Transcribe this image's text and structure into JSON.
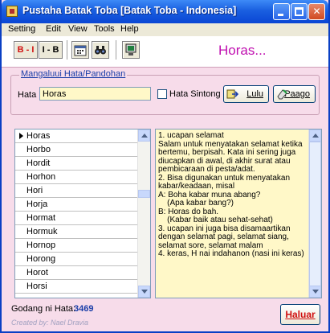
{
  "window": {
    "title": "Pustaha Batak Toba   [Batak Toba - Indonesia]"
  },
  "menu": [
    "Setting",
    "Edit",
    "View",
    "Tools",
    "Help"
  ],
  "toolbar": {
    "btn_bi": "B - I",
    "btn_ib": "I - B",
    "greeting": "Horas..."
  },
  "search": {
    "group_title": "Mangaluui Hata/Pandohan",
    "hata_label": "Hata",
    "hata_value": "Horas",
    "sintong_label": "Hata Sintong",
    "sintong_checked": false,
    "lulu_label": "Lulu",
    "paago_label": "Paago"
  },
  "word_list": {
    "selected_index": 0,
    "items": [
      "Horas",
      "Horbo",
      "Hordit",
      "Horhon",
      "Hori",
      "Horja",
      "Hormat",
      "Hormuk",
      "Hornop",
      "Horong",
      "Horot",
      "Horsi"
    ]
  },
  "meaning": "1. ucapan selamat\nSalam untuk menyatakan selamat ketika bertemu, berpisah. Kata ini sering juga diucapkan di awal, di akhir surat atau pembicaraan di pesta/adat.\n2. Bisa digunakan untuk menyatakan kabar/keadaan, misal\nA: Boha kabar muna abang?\n    (Apa kabar bang?)\nB: Horas do bah.\n    (Kabar baik atau sehat-sehat)\n3. ucapan ini juga bisa disamaartikan dengan selamat pagi, selamat siang, selamat sore, selamat malam\n4. keras, H nai indahanon (nasi ini keras)",
  "footer": {
    "count_label": "Godang ni Hata:",
    "count_value": "3469",
    "credit": "Created by: Nael Dravia",
    "exit_label": "Haluar"
  },
  "colors": {
    "window_bg": "#f7dcea",
    "accent": "#c010b0",
    "field_bg": "#fff8c8",
    "title_blue": "#0a46d4"
  }
}
